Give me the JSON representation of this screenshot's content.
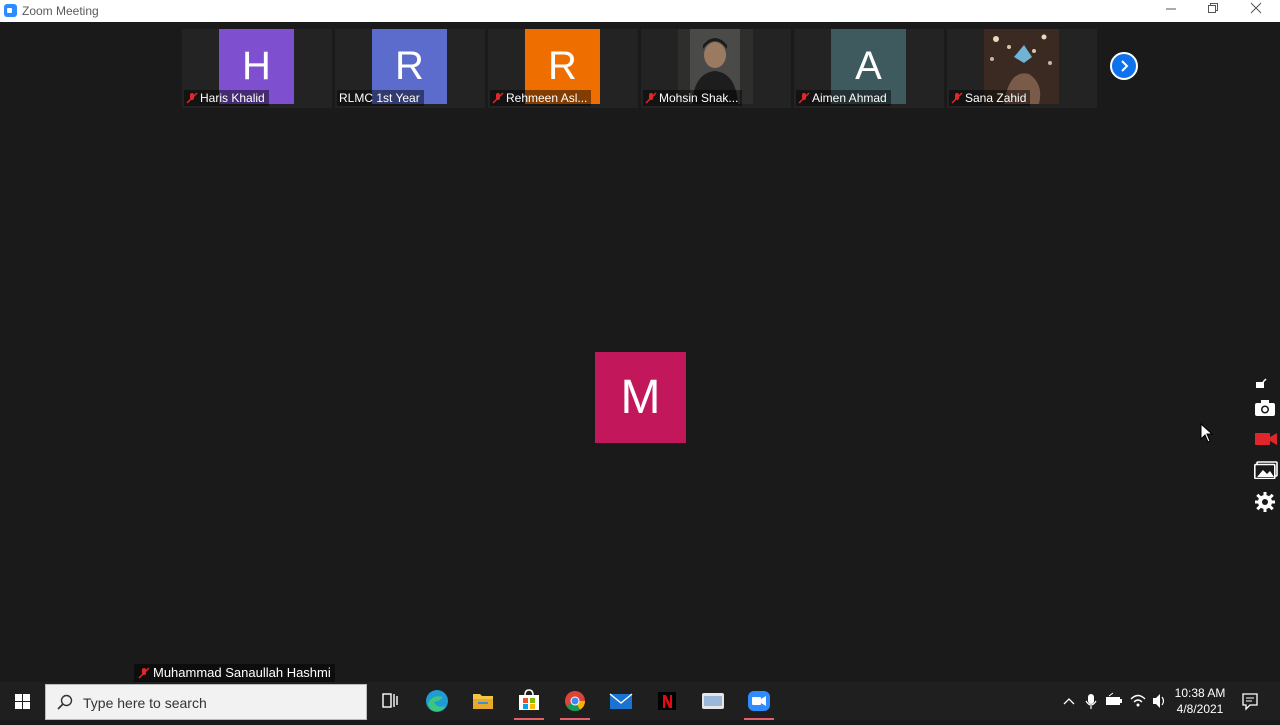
{
  "window": {
    "title": "Zoom Meeting"
  },
  "participants": [
    {
      "name": "Haris Khalid",
      "initial": "H",
      "color": "#7e4fcf",
      "muted": true
    },
    {
      "name": "RLMC 1st Year",
      "initial": "R",
      "color": "#5b6ccd",
      "muted": false
    },
    {
      "name": "Rehmeen Asl...",
      "initial": "R",
      "color": "#ee6f00",
      "muted": true
    },
    {
      "name": "Mohsin Shak...",
      "initial": "",
      "color": "#3a3a3a",
      "muted": true
    },
    {
      "name": "Aimen Ahmad",
      "initial": "A",
      "color": "#3f5a5e",
      "muted": true
    },
    {
      "name": "Sana Zahid",
      "initial": "",
      "color": "#4a3a33",
      "muted": true
    }
  ],
  "active_speaker": {
    "initial": "M",
    "name": "Muhammad Sanaullah Hashmi",
    "color": "#c2185b"
  },
  "taskbar": {
    "search_placeholder": "Type here to search",
    "time": "10:38 AM",
    "date": "4/8/2021"
  }
}
